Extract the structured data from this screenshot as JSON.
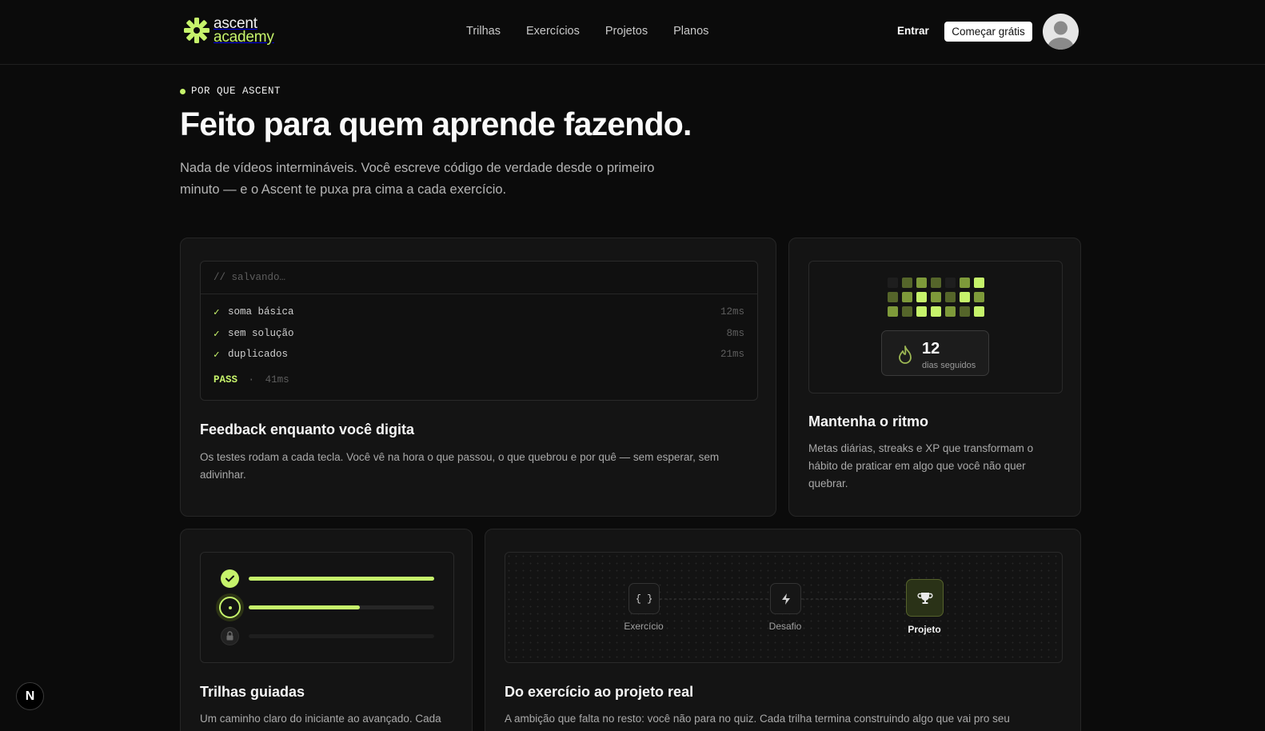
{
  "header": {
    "logo": {
      "line1": "ascent",
      "line2": "academy"
    },
    "nav": [
      {
        "label": "Trilhas"
      },
      {
        "label": "Exercícios"
      },
      {
        "label": "Projetos"
      },
      {
        "label": "Planos"
      }
    ],
    "login_label": "Entrar",
    "cta_label": "Começar grátis"
  },
  "hero": {
    "eyebrow": "POR QUE ASCENT",
    "title": "Feito para quem aprende fazendo.",
    "subtitle": "Nada de vídeos intermináveis. Você escreve código de verdade desde o primeiro minuto — e o Ascent te puxa pra cima a cada exercício."
  },
  "features": {
    "feedback": {
      "code_header": "// salvando…",
      "tests": [
        {
          "check": "✓",
          "name": "soma básica",
          "time": "12ms"
        },
        {
          "check": "✓",
          "name": "sem solução",
          "time": "8ms"
        },
        {
          "check": "✓",
          "name": "duplicados",
          "time": "21ms"
        }
      ],
      "status": "PASS",
      "separator": "·",
      "total": "41ms",
      "title": "Feedback enquanto você digita",
      "description": "Os testes rodam a cada tecla. Você vê na hora o que passou, o que quebrou e por quê — sem esperar, sem adivinhar."
    },
    "streak": {
      "days": "12",
      "days_label": "dias seguidos",
      "activity_levels": [
        [
          0,
          2,
          3,
          2,
          0,
          3,
          4
        ],
        [
          2,
          3,
          4,
          3,
          2,
          4,
          3
        ],
        [
          3,
          2,
          4,
          4,
          3,
          2,
          4
        ]
      ],
      "title": "Mantenha o ritmo",
      "description": "Metas diárias, streaks e XP que transformam o hábito de praticar em algo que você não quer quebrar."
    },
    "tracks": {
      "steps": [
        {
          "state": "done",
          "progress": 1.0
        },
        {
          "state": "current",
          "progress": 0.6
        },
        {
          "state": "locked",
          "progress": 0
        }
      ],
      "title": "Trilhas guiadas",
      "description": "Um caminho claro do iniciante ao avançado. Cada"
    },
    "journey": {
      "stages": [
        {
          "label": "Exercício",
          "icon": "braces-icon"
        },
        {
          "label": "Desafio",
          "icon": "lightning-icon"
        },
        {
          "label": "Projeto",
          "icon": "trophy-icon"
        }
      ],
      "title": "Do exercício ao projeto real",
      "description": "A ambição que falta no resto: você não para no quiz. Cada trilha termina construindo algo que vai pro seu"
    }
  },
  "colors": {
    "accent": "#c6f36b",
    "background": "#0b0b0b",
    "card": "#141414"
  },
  "dev_badge": "N"
}
